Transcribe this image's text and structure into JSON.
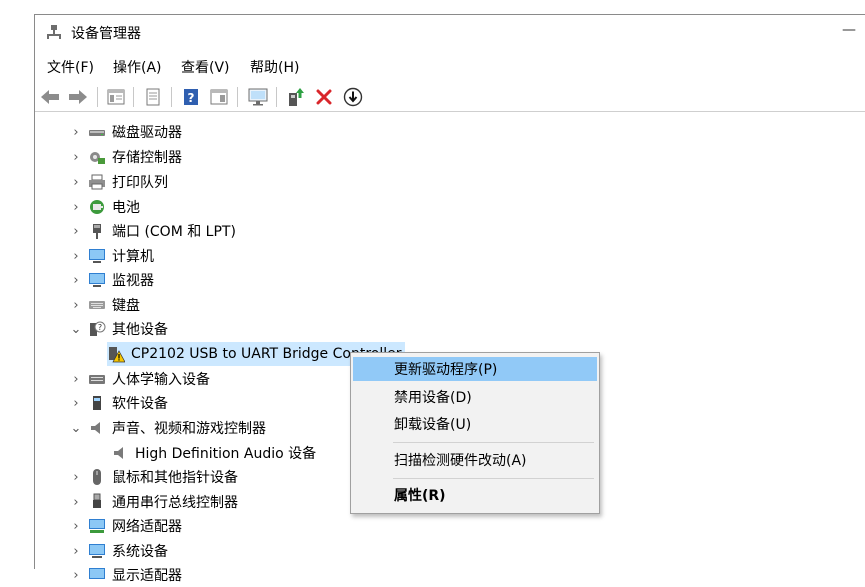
{
  "window": {
    "title": "设备管理器",
    "minimize_glyph": "—"
  },
  "menu": [
    {
      "label": "文件(F)"
    },
    {
      "label": "操作(A)"
    },
    {
      "label": "查看(V)"
    },
    {
      "label": "帮助(H)"
    }
  ],
  "toolbar": [
    {
      "icon": "back-arrow-icon"
    },
    {
      "icon": "forward-arrow-icon"
    },
    {
      "icon": "show-hide-tree-icon"
    },
    {
      "icon": "properties-icon"
    },
    {
      "icon": "help-icon"
    },
    {
      "icon": "view-panel-icon"
    },
    {
      "icon": "scan-monitor-icon"
    },
    {
      "icon": "update-driver-icon"
    },
    {
      "icon": "uninstall-x-icon"
    },
    {
      "icon": "disable-down-icon"
    }
  ],
  "tree": [
    {
      "label": "磁盘驱动器",
      "icon": "disk-drive-icon",
      "expanded": false
    },
    {
      "label": "存储控制器",
      "icon": "storage-controller-icon",
      "expanded": false
    },
    {
      "label": "打印队列",
      "icon": "printer-icon",
      "expanded": false
    },
    {
      "label": "电池",
      "icon": "battery-icon",
      "expanded": false
    },
    {
      "label": "端口 (COM 和 LPT)",
      "icon": "port-icon",
      "expanded": false
    },
    {
      "label": "计算机",
      "icon": "computer-icon",
      "expanded": false
    },
    {
      "label": "监视器",
      "icon": "monitor-icon",
      "expanded": false
    },
    {
      "label": "键盘",
      "icon": "keyboard-icon",
      "expanded": false
    },
    {
      "label": "其他设备",
      "icon": "unknown-device-icon",
      "expanded": true
    },
    {
      "label": "CP2102 USB to UART Bridge Controller",
      "icon": "warning-device-icon",
      "child": true,
      "selected": true
    },
    {
      "label": "人体学输入设备",
      "icon": "hid-icon",
      "expanded": false
    },
    {
      "label": "软件设备",
      "icon": "software-device-icon",
      "expanded": false
    },
    {
      "label": "声音、视频和游戏控制器",
      "icon": "speaker-icon",
      "expanded": true
    },
    {
      "label": "High Definition Audio 设备",
      "icon": "speaker-icon",
      "child": true
    },
    {
      "label": "鼠标和其他指针设备",
      "icon": "mouse-icon",
      "expanded": false
    },
    {
      "label": "通用串行总线控制器",
      "icon": "usb-icon",
      "expanded": false
    },
    {
      "label": "网络适配器",
      "icon": "network-adapter-icon",
      "expanded": false
    },
    {
      "label": "系统设备",
      "icon": "system-device-icon",
      "expanded": false
    },
    {
      "label": "显示适配器",
      "icon": "display-adapter-icon",
      "expanded": false
    }
  ],
  "context_menu": {
    "items": [
      {
        "label": "更新驱动程序(P)",
        "highlighted": true
      },
      {
        "label": "禁用设备(D)"
      },
      {
        "label": "卸载设备(U)"
      },
      {
        "label": "扫描检测硬件改动(A)"
      },
      {
        "label": "属性(R)",
        "bold": true
      }
    ]
  },
  "colors": {
    "selection": "#cce8ff",
    "menu_highlight": "#91c9f7",
    "delete_red": "#d9262b",
    "icon_blue": "#2f7fd1"
  }
}
